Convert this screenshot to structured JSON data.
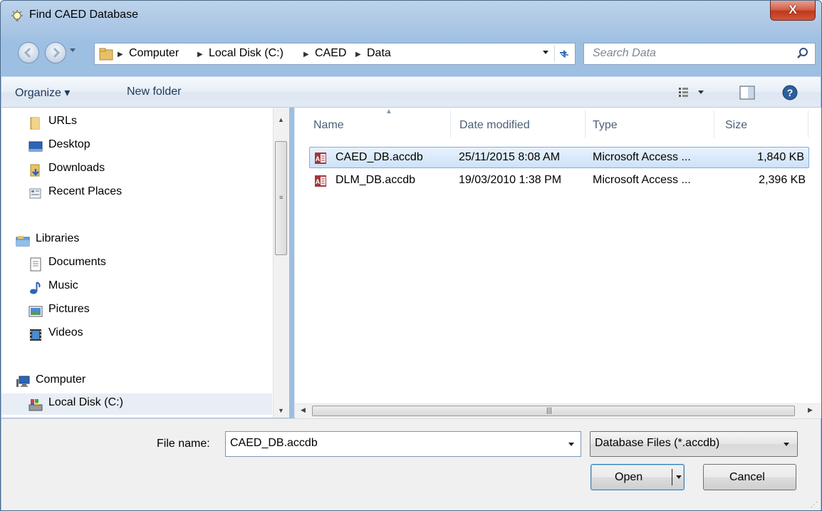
{
  "window": {
    "title": "Find CAED Database",
    "close_label": "X"
  },
  "nav": {
    "breadcrumbs": [
      "Computer",
      "Local Disk (C:)",
      "CAED",
      "Data"
    ],
    "search_placeholder": "Search Data"
  },
  "commands": {
    "organize": "Organize ▾",
    "new_folder": "New folder"
  },
  "navpane": {
    "items": [
      {
        "label": "URLs",
        "icon": "folder-icon"
      },
      {
        "label": "Desktop",
        "icon": "desktop-icon"
      },
      {
        "label": "Downloads",
        "icon": "downloads-icon"
      },
      {
        "label": "Recent Places",
        "icon": "recent-places-icon"
      },
      {
        "label": "Libraries",
        "icon": "libraries-icon"
      },
      {
        "label": "Documents",
        "icon": "documents-icon"
      },
      {
        "label": "Music",
        "icon": "music-icon"
      },
      {
        "label": "Pictures",
        "icon": "pictures-icon"
      },
      {
        "label": "Videos",
        "icon": "videos-icon"
      },
      {
        "label": "Computer",
        "icon": "computer-icon"
      },
      {
        "label": "Local Disk (C:)",
        "icon": "local-disk-icon",
        "selected": true
      }
    ]
  },
  "filelist": {
    "columns": [
      "Name",
      "Date modified",
      "Type",
      "Size"
    ],
    "rows": [
      {
        "name": "CAED_DB.accdb",
        "date": "25/11/2015 8:08 AM",
        "type": "Microsoft Access ...",
        "size": "1,840 KB",
        "selected": true
      },
      {
        "name": "DLM_DB.accdb",
        "date": "19/03/2010 1:38 PM",
        "type": "Microsoft Access ...",
        "size": "2,396 KB",
        "selected": false
      }
    ]
  },
  "bottom": {
    "file_name_label": "File name:",
    "file_name_value": "CAED_DB.accdb",
    "file_type_value": "Database Files (*.accdb)",
    "open_label": "Open",
    "cancel_label": "Cancel"
  },
  "colors": {
    "title_gradient_top": "#bcd3ea",
    "close_red": "#c1381c",
    "selection_border": "#84acdd",
    "link_text": "#1e395b"
  }
}
